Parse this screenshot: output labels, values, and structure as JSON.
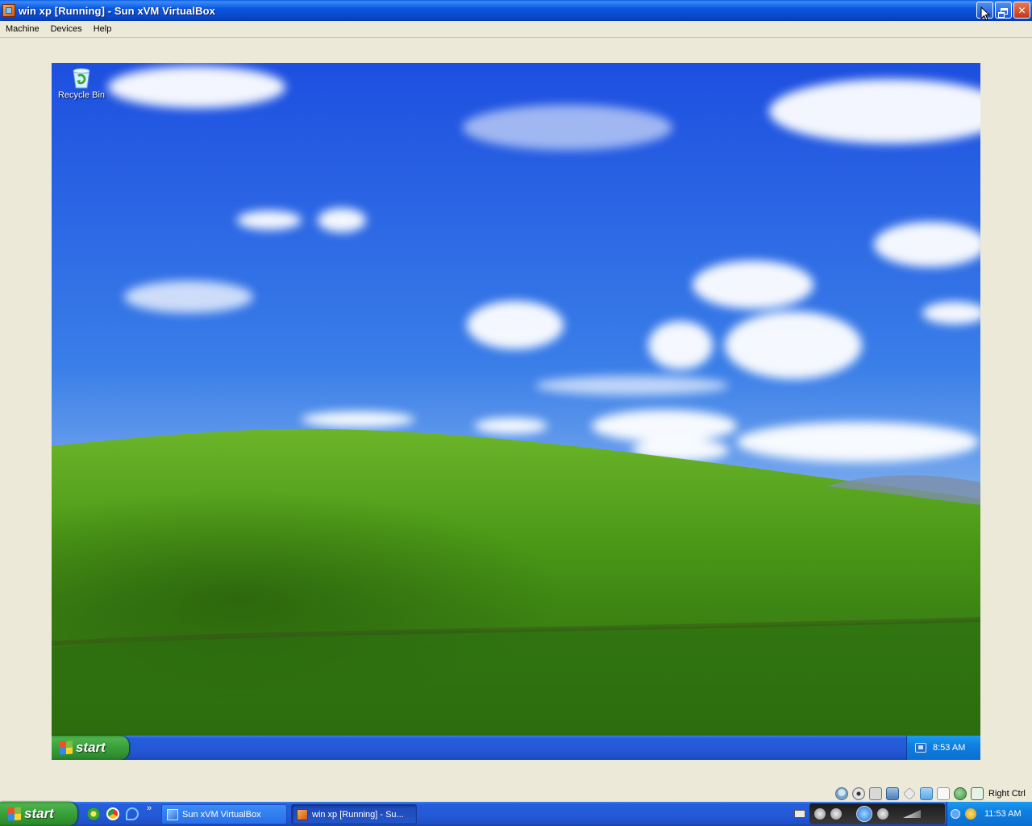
{
  "window": {
    "title": "win xp [Running] - Sun xVM VirtualBox",
    "controls": [
      "minimize",
      "restore",
      "close"
    ]
  },
  "menubar": {
    "items": [
      "Machine",
      "Devices",
      "Help"
    ]
  },
  "guest": {
    "desktop_icons": [
      {
        "label": "Recycle Bin",
        "icon": "recycle-bin-icon"
      }
    ],
    "taskbar": {
      "start_label": "start",
      "clock": "8:53 AM"
    }
  },
  "vbox_status": {
    "icons": [
      "hard-disk-icon",
      "cd-dvd-icon",
      "floppy-icon",
      "network-icon",
      "usb-icon",
      "shared-folder-icon",
      "capture-icon",
      "mouse-integration-icon",
      "keyboard-capture-icon"
    ],
    "host_key": "Right Ctrl"
  },
  "host_taskbar": {
    "start_label": "start",
    "quick_launch": [
      "media-icon",
      "chrome-icon",
      "ie-icon"
    ],
    "quick_launch_more": "»",
    "tasks": [
      {
        "label": "Sun xVM VirtualBox",
        "active": false
      },
      {
        "label": "win xp [Running] - Su...",
        "active": true
      }
    ],
    "clock": "11:53 AM"
  },
  "colors": {
    "titlebar": "#0a58e0",
    "start_green": "#38a038",
    "taskbar_blue": "#2559d6",
    "dialog_bg": "#ece9d8"
  }
}
